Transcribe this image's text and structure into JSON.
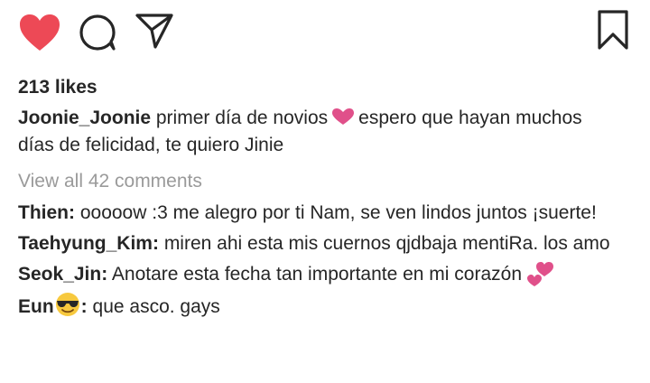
{
  "post": {
    "likes_text": "213 likes",
    "caption": {
      "user": "Joonie_Joonie",
      "text_before": "primer día de novios",
      "text_after": "espero que hayan muchos días de felicidad, te quiero Jinie"
    },
    "view_all_comments": "View all 42 comments",
    "comments": [
      {
        "user": "Thien:",
        "text": "ooooow :3 me alegro por ti Nam, se ven lindos juntos ¡suerte!"
      },
      {
        "user": "Taehyung_Kim:",
        "text": "miren ahi esta mis cuernos qjdbaja mentiRa. los amo"
      },
      {
        "user": "Seok_Jin:",
        "text": "Anotare esta fecha tan importante en mi corazón"
      },
      {
        "user_prefix": "Eun",
        "user_suffix": ":",
        "text": "que asco. gays"
      }
    ]
  },
  "icons": {
    "like": "heart-icon",
    "comment": "comment-icon",
    "share": "paper-plane-icon",
    "save": "bookmark-icon",
    "caption_emoji": "pink-heart-emoji",
    "comment_emoji": "two-hearts-emoji",
    "user_emoji": "sunglasses-emoji"
  },
  "colors": {
    "like_red": "#ed4956",
    "text": "#262626",
    "muted": "#9a9a9a",
    "emoji_pink": "#e0508a"
  }
}
